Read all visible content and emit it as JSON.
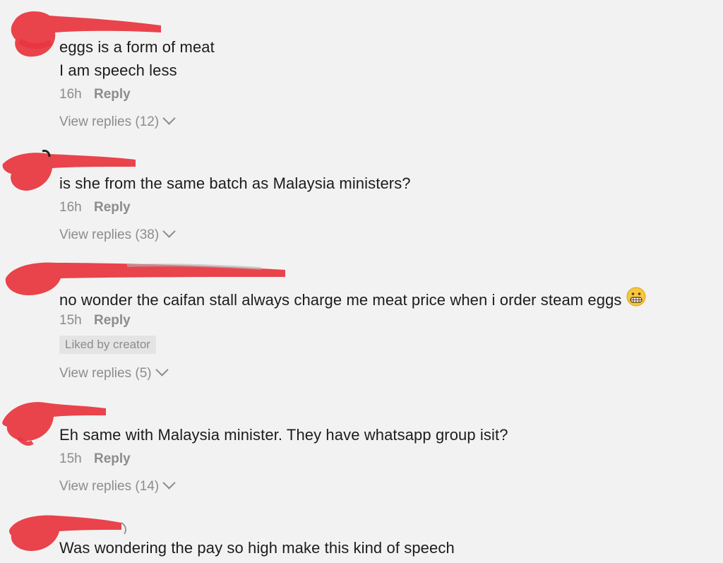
{
  "comments": [
    {
      "lines": [
        "eggs is a form of meat",
        "I am speech less"
      ],
      "time": "16h",
      "reply_label": "Reply",
      "view_replies": "View replies (12)"
    },
    {
      "lines": [
        "is she from the same batch as Malaysia ministers?"
      ],
      "time": "16h",
      "reply_label": "Reply",
      "view_replies": "View replies (38)"
    },
    {
      "lines": [
        "no wonder the caifan stall always charge me meat price when i order steam eggs"
      ],
      "emoji": "grimacing-face",
      "time": "15h",
      "reply_label": "Reply",
      "badge": "Liked by creator",
      "view_replies": "View replies (5)"
    },
    {
      "lines": [
        "Eh same with Malaysia minister. They have whatsapp group isit?"
      ],
      "time": "15h",
      "reply_label": "Reply",
      "view_replies": "View replies (14)"
    },
    {
      "lines": [
        "Was wondering the pay so high make this kind of speech"
      ]
    }
  ],
  "colors": {
    "background": "#f2f2f2",
    "text": "#1c1c1c",
    "meta": "#8c8c8c",
    "redaction": "#e8363f",
    "badge_bg": "#e4e4e4"
  }
}
